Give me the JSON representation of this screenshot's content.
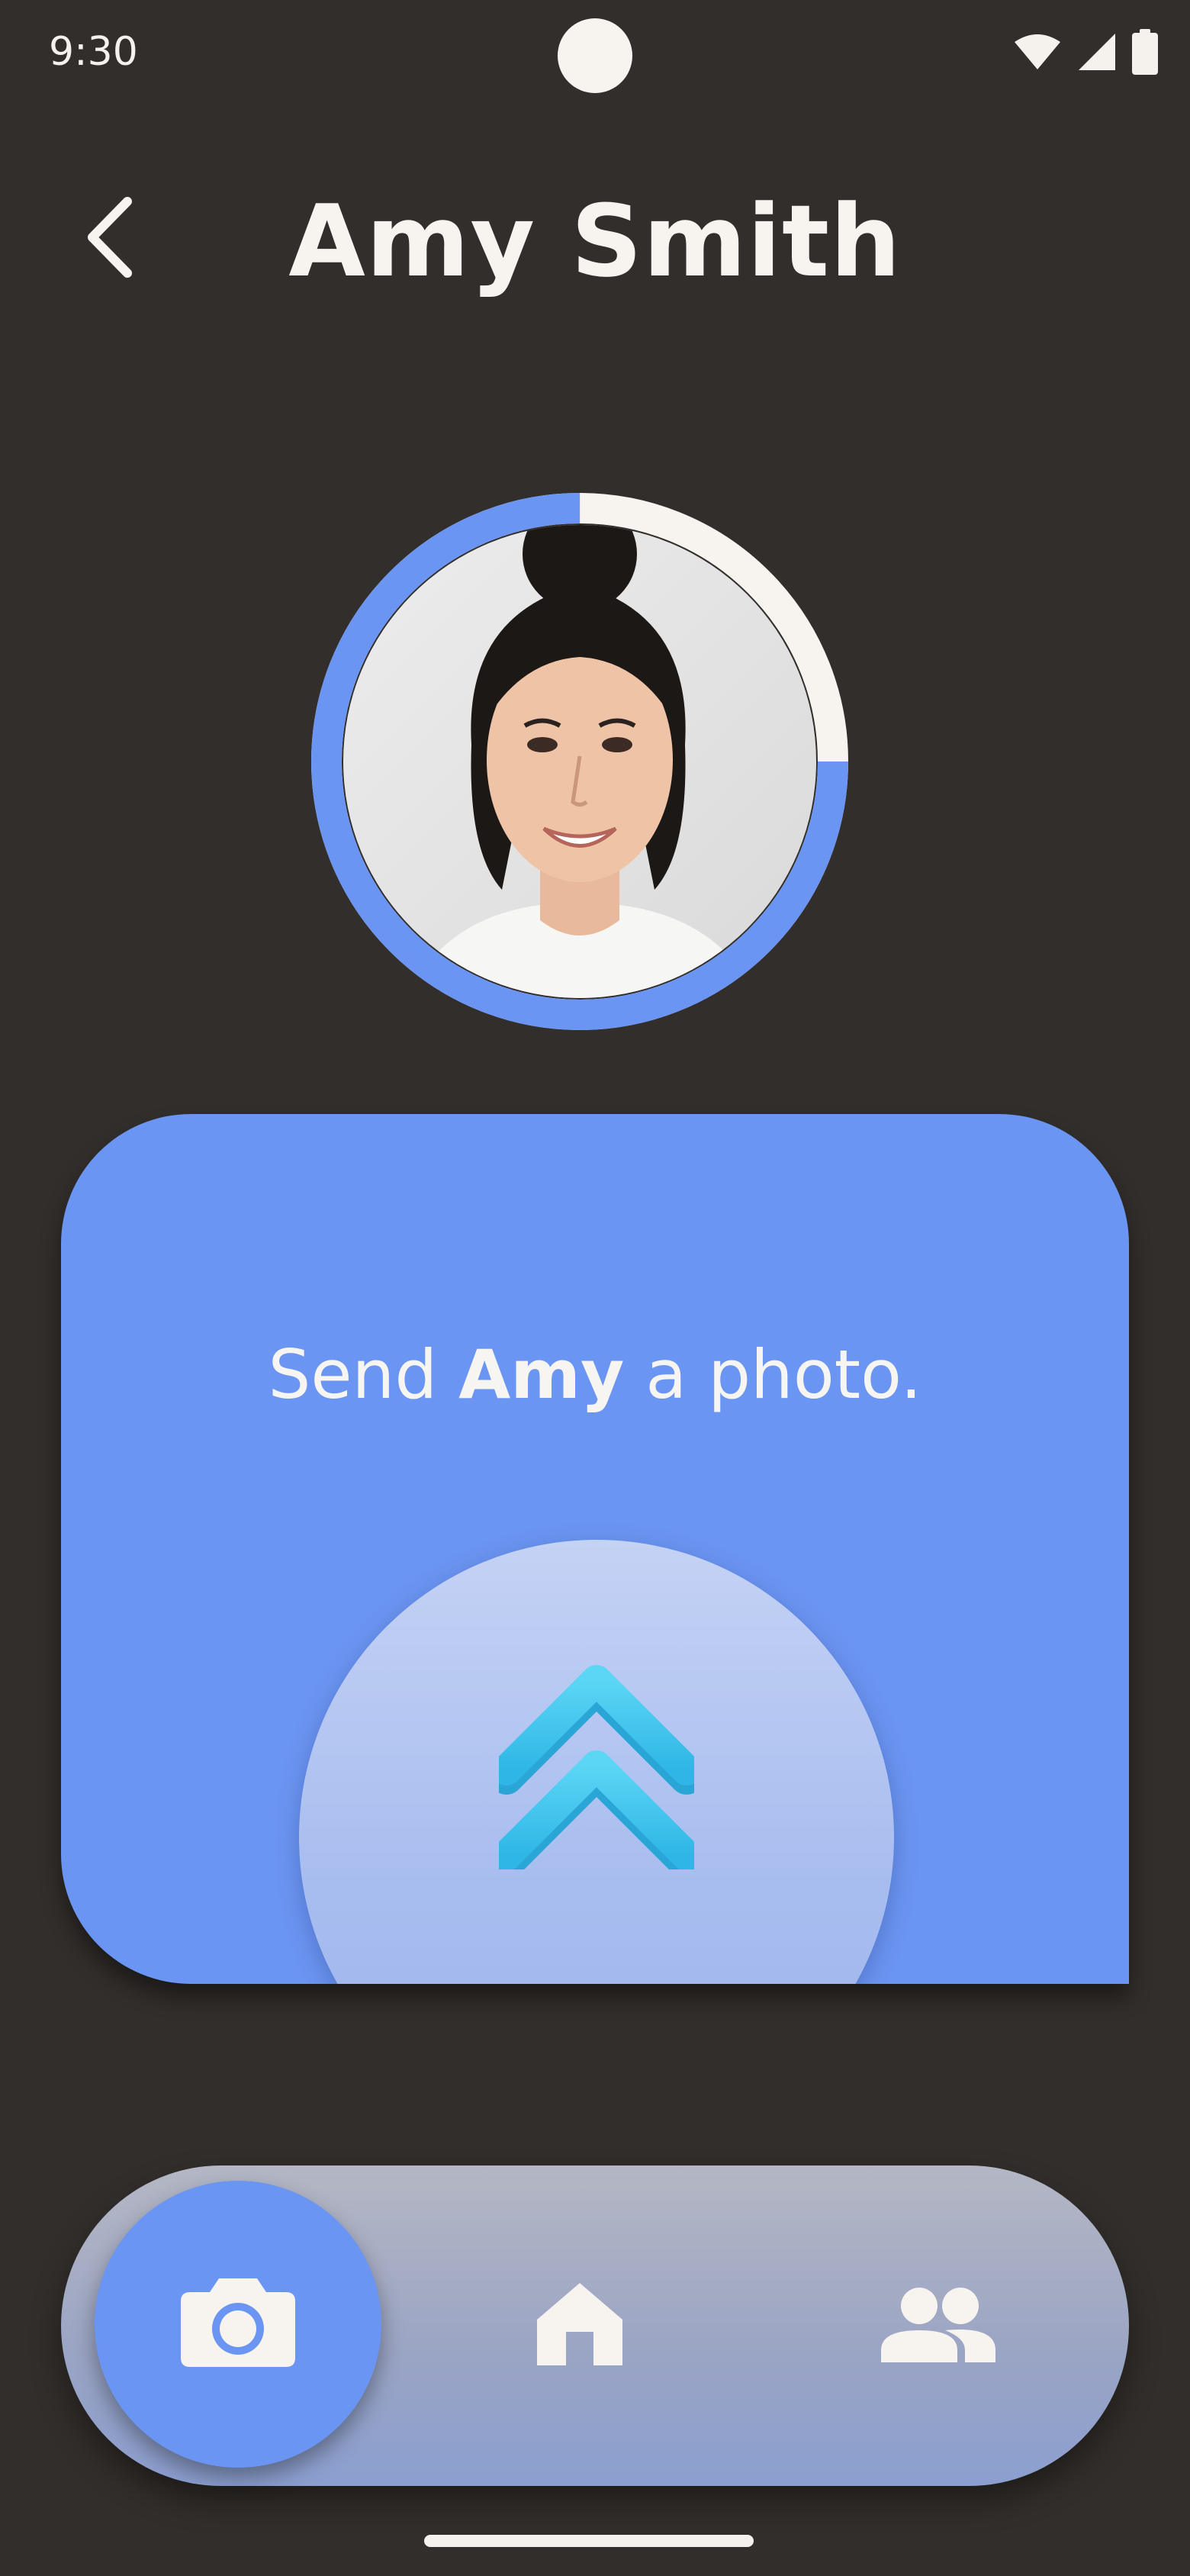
{
  "status_bar": {
    "time": "9:30",
    "icons": [
      "wifi-icon",
      "cellular-signal-icon",
      "battery-icon"
    ]
  },
  "header": {
    "back_icon": "chevron-left-icon",
    "title": "Amy Smith"
  },
  "profile": {
    "avatar": "profile-photo",
    "ring_progress": 0.75,
    "ring_color": "#6b95f2",
    "ring_track_color": "#f7f3ee"
  },
  "send_card": {
    "text_prefix": "Send ",
    "name": "Amy",
    "text_suffix": " a photo.",
    "button_icon": "double-chevron-up-icon",
    "background": "#6b95f2"
  },
  "bottom_nav": {
    "items": [
      {
        "name": "camera",
        "icon": "camera-icon",
        "active": true
      },
      {
        "name": "home",
        "icon": "home-icon",
        "active": false
      },
      {
        "name": "friends",
        "icon": "people-icon",
        "active": false
      }
    ]
  },
  "colors": {
    "background": "#322e2b",
    "accent": "#6b95f2",
    "text": "#f7f3ee"
  }
}
